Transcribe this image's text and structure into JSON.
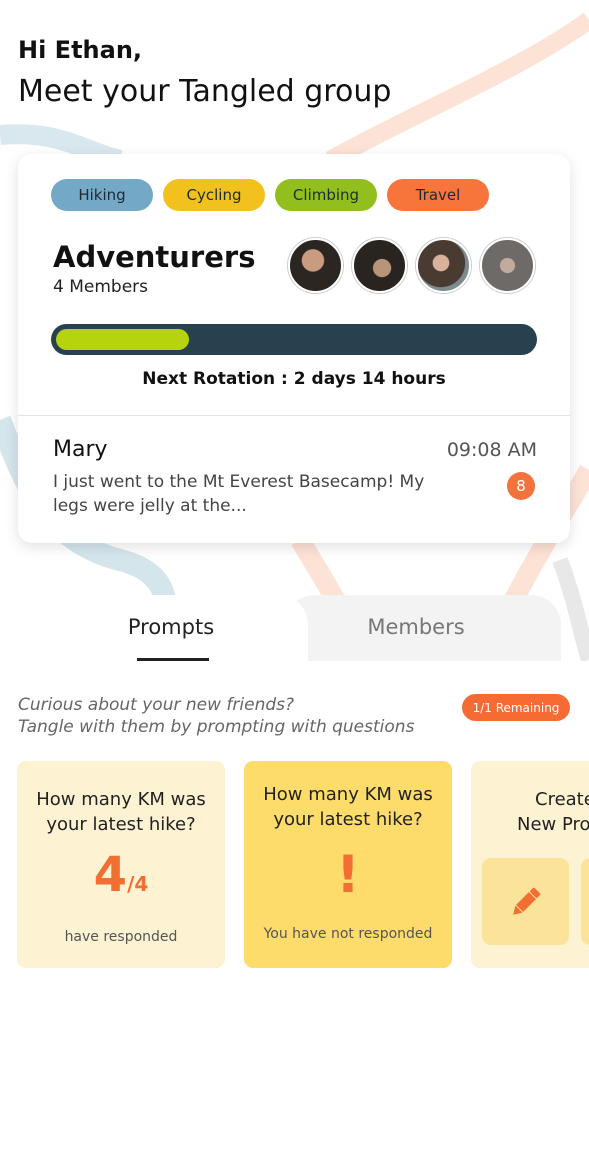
{
  "greeting": {
    "hi": "Hi Ethan,",
    "subtitle": "Meet your Tangled group"
  },
  "group": {
    "tags": [
      "Hiking",
      "Cycling",
      "Climbing",
      "Travel"
    ],
    "name": "Adventurers",
    "member_count": "4 Members",
    "avatars": [
      "member-avatar",
      "member-avatar",
      "member-avatar",
      "member-avatar"
    ],
    "rotation_progress": 0.28,
    "next_rotation": "Next Rotation : 2 days 14 hours",
    "last_message": {
      "author": "Mary",
      "time": "09:08 AM",
      "text": "I just went to the Mt Everest Basecamp! My legs were jelly at the...",
      "unread": "8"
    }
  },
  "tabs": {
    "prompts": "Prompts",
    "members": "Members",
    "active": "prompts"
  },
  "prompts": {
    "intro_line1": "Curious about your new friends?",
    "intro_line2": "Tangle with them by prompting with questions",
    "remaining": "1/1 Remaining",
    "cards": [
      {
        "question": "How many KM was your latest hike?",
        "responded": "4",
        "total": "/4",
        "status": "have responded"
      },
      {
        "question": "How many KM was your latest hike?",
        "alert": "!",
        "status": "You have not responded"
      }
    ],
    "create": {
      "line1": "Create",
      "line2": "New Prompt"
    }
  },
  "colors": {
    "hiking": "#73a9c6",
    "cycling": "#f2c11d",
    "climbing": "#93bf1e",
    "travel": "#f7743a",
    "progress_track": "#27414e",
    "progress_fill": "#b6d40d",
    "accent": "#f26e33"
  }
}
